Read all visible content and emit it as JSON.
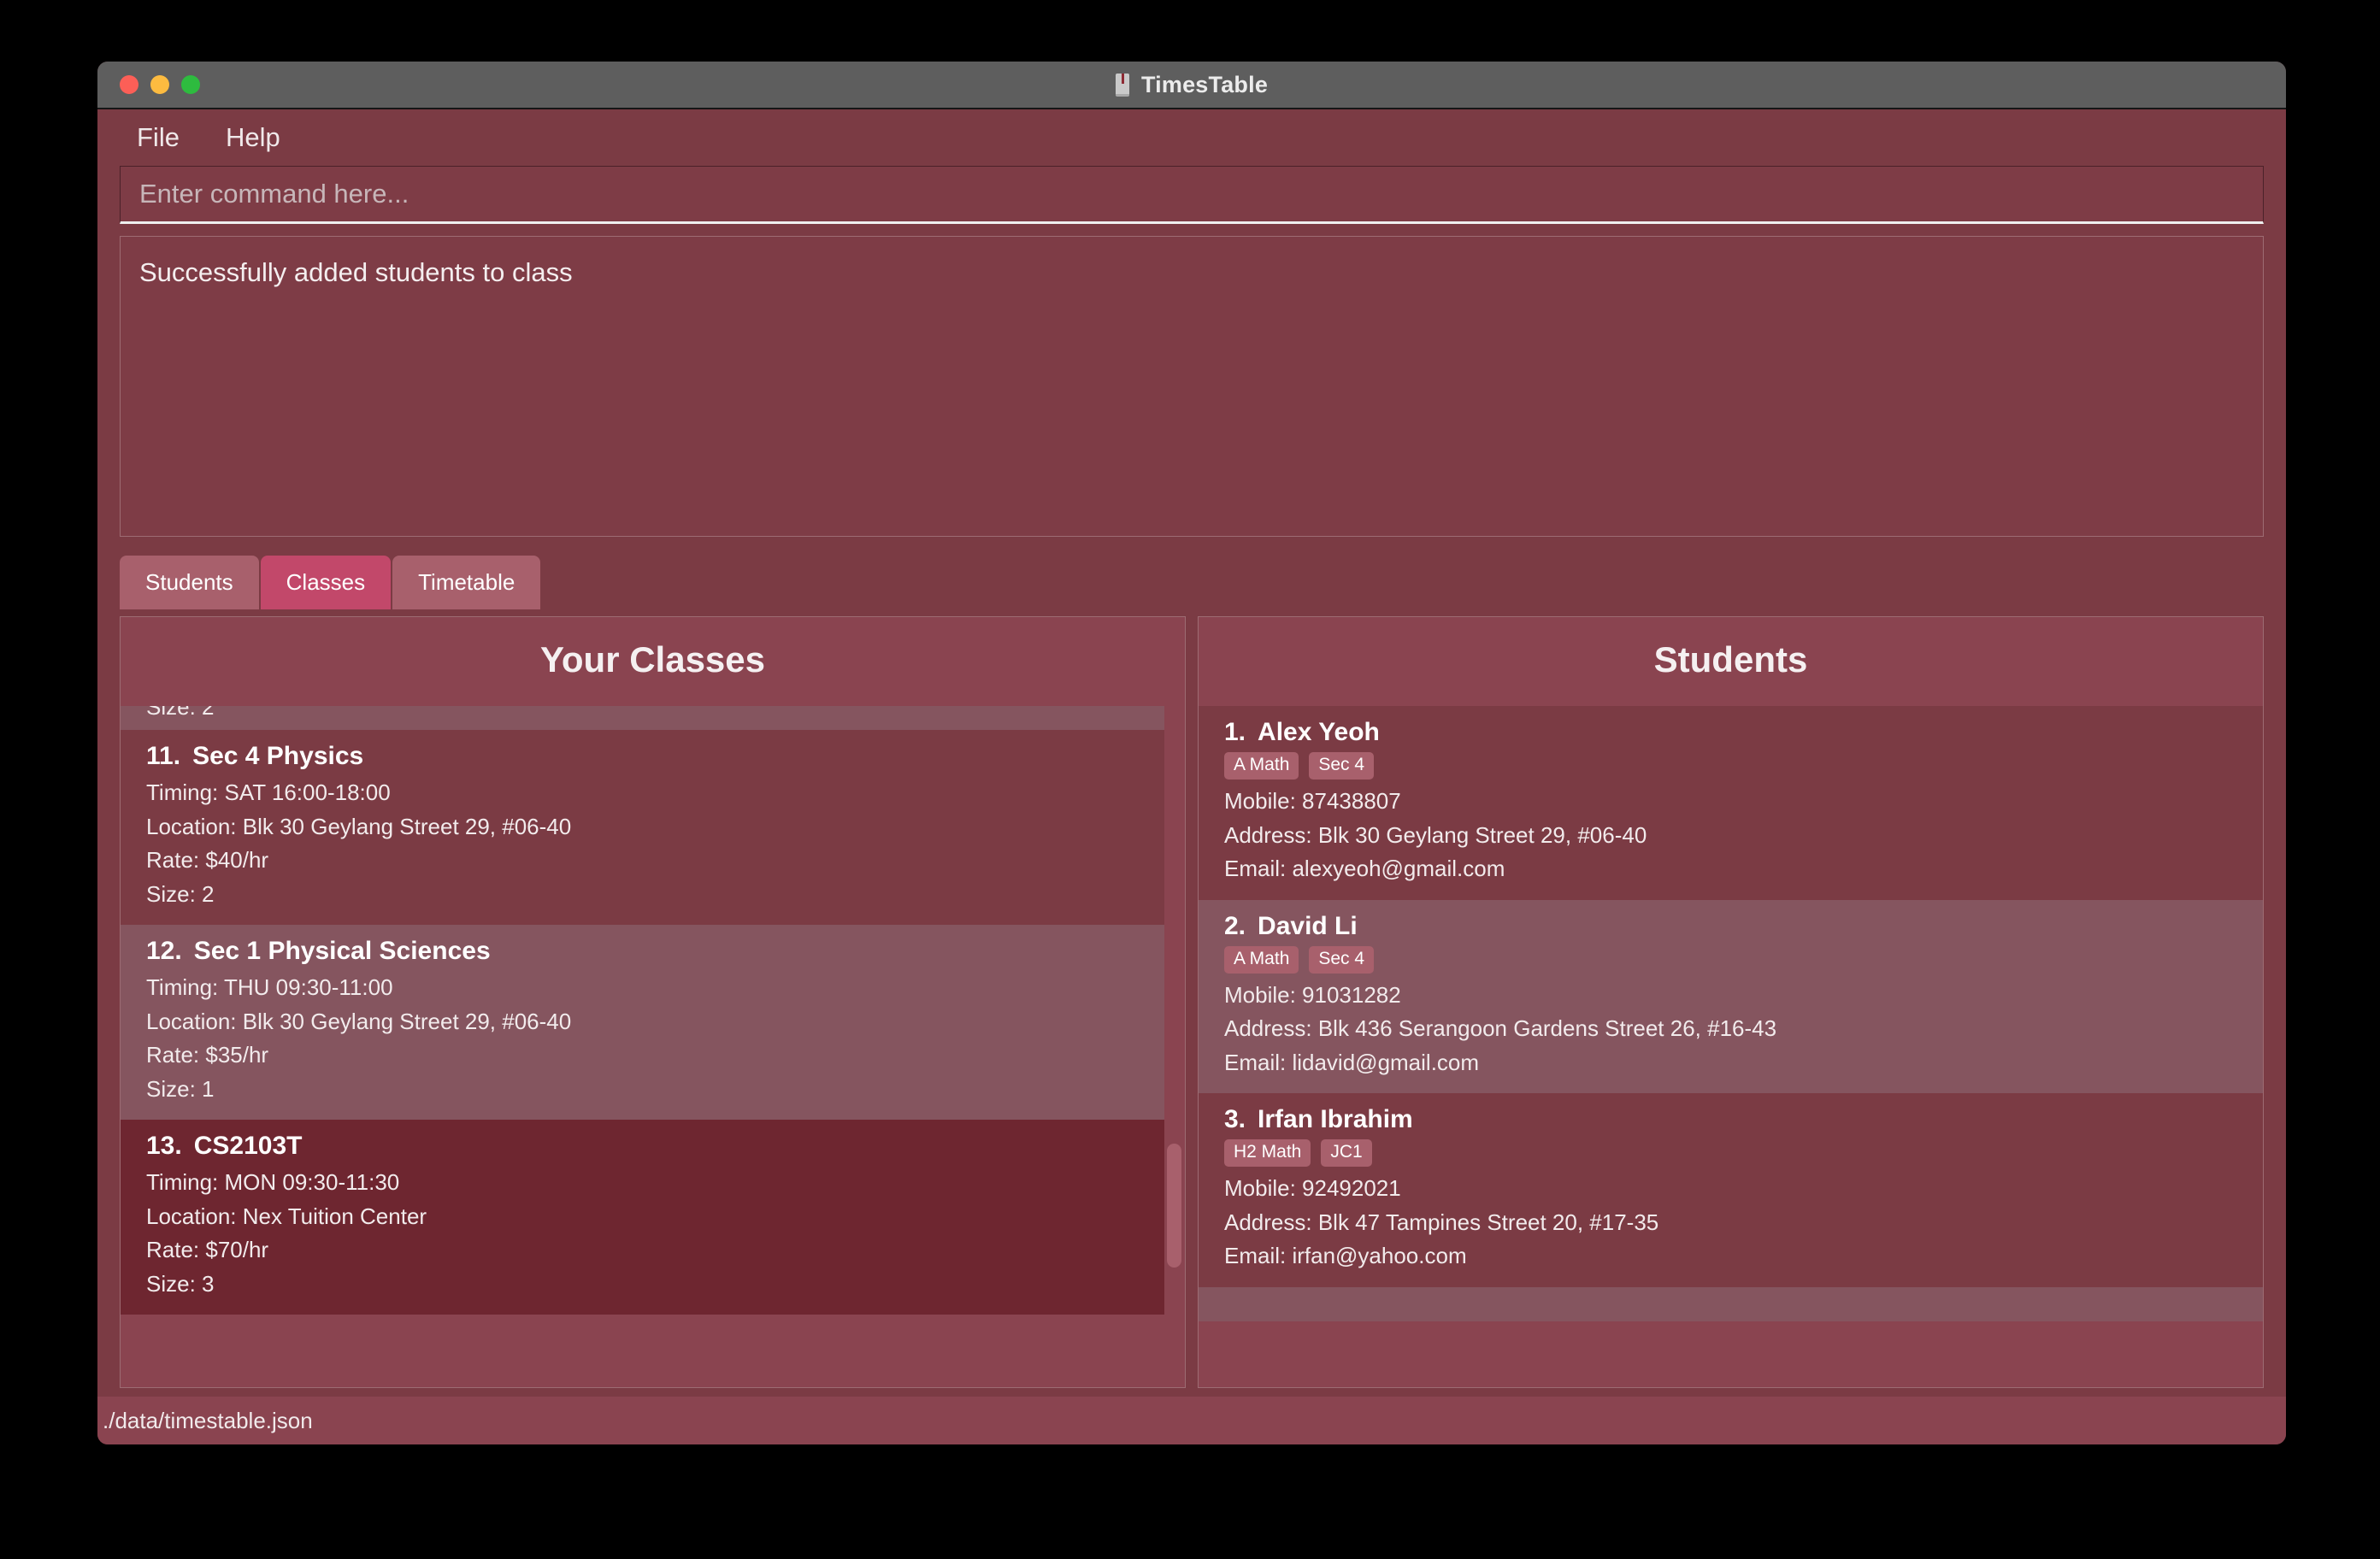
{
  "window": {
    "title": "TimesTable",
    "app_icon": "book-icon",
    "traffic_lights": [
      {
        "name": "close",
        "color": "#fc5f57"
      },
      {
        "name": "minimize",
        "color": "#fcbb40"
      },
      {
        "name": "maximize",
        "color": "#2ebb3f"
      }
    ]
  },
  "menubar": {
    "items": [
      {
        "label": "File"
      },
      {
        "label": "Help"
      }
    ]
  },
  "command": {
    "placeholder": "Enter command here...",
    "value": ""
  },
  "result": {
    "message": "Successfully added students to class"
  },
  "tabs": [
    {
      "label": "Students",
      "active": false
    },
    {
      "label": "Classes",
      "active": true
    },
    {
      "label": "Timetable",
      "active": false
    }
  ],
  "classes_panel": {
    "title": "Your Classes",
    "clipped_top": {
      "line": "Size: 2"
    },
    "items": [
      {
        "index": "11.",
        "name": "Sec 4 Physics",
        "timing": "Timing: SAT 16:00-18:00",
        "location": "Location: Blk 30 Geylang Street 29, #06-40",
        "rate": "Rate: $40/hr",
        "size": "Size: 2",
        "style": "base"
      },
      {
        "index": "12.",
        "name": "Sec 1 Physical Sciences",
        "timing": "Timing: THU 09:30-11:00",
        "location": "Location: Blk 30 Geylang Street 29, #06-40",
        "rate": "Rate: $35/hr",
        "size": "Size: 1",
        "style": "alt"
      },
      {
        "index": "13.",
        "name": "CS2103T",
        "timing": "Timing: MON 09:30-11:30",
        "location": "Location: Nex Tuition Center",
        "rate": "Rate: $70/hr",
        "size": "Size: 3",
        "style": "selected"
      }
    ]
  },
  "students_panel": {
    "title": "Students",
    "items": [
      {
        "index": "1.",
        "name": "Alex Yeoh",
        "tags": [
          "A Math",
          "Sec 4"
        ],
        "mobile": "Mobile: 87438807",
        "address": "Address: Blk 30 Geylang Street 29, #06-40",
        "email": "Email: alexyeoh@gmail.com",
        "style": "base"
      },
      {
        "index": "2.",
        "name": "David Li",
        "tags": [
          "A Math",
          "Sec 4"
        ],
        "mobile": "Mobile: 91031282",
        "address": "Address: Blk 436 Serangoon Gardens Street 26, #16-43",
        "email": "Email: lidavid@gmail.com",
        "style": "alt"
      },
      {
        "index": "3.",
        "name": "Irfan Ibrahim",
        "tags": [
          "H2 Math",
          "JC1"
        ],
        "mobile": "Mobile: 92492021",
        "address": "Address: Blk 47 Tampines Street 20, #17-35",
        "email": "Email: irfan@yahoo.com",
        "style": "base"
      }
    ]
  },
  "statusbar": {
    "path": "./data/timestable.json"
  },
  "colors": {
    "window_bg": "#7b3b44",
    "panel_bg": "#8a4450",
    "row_alt": "#85555f",
    "row_selected": "#6e2630",
    "tab_active": "#c2486a",
    "tab_inactive": "#a8606c",
    "titlebar": "#5e5e5e",
    "text": "#f4eeef"
  }
}
